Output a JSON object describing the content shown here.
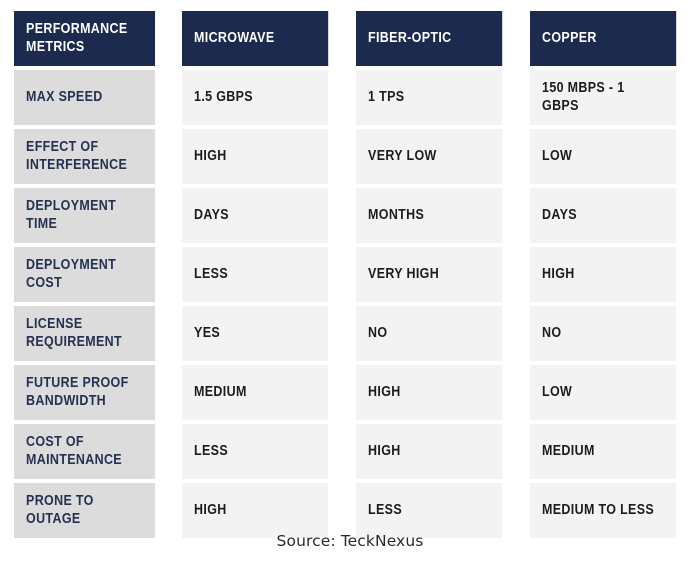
{
  "table": {
    "columns": [
      {
        "key": "metric",
        "label": "PERFORMANCE METRICS",
        "label_line1": "PERFORMANCE",
        "label_line2": "METRICS"
      },
      {
        "key": "microwave",
        "label": "MICROWAVE"
      },
      {
        "key": "fiber",
        "label": "FIBER-OPTIC"
      },
      {
        "key": "copper",
        "label": "COPPER"
      }
    ],
    "rows": [
      {
        "metric": "MAX SPEED",
        "metric_line1": "MAX SPEED",
        "metric_line2": "",
        "microwave": "1.5 GBPS",
        "fiber": "1 TPS",
        "copper": "150 MBPS - 1 GBPS"
      },
      {
        "metric": "EFFECT OF INTERFERENCE",
        "metric_line1": "EFFECT OF",
        "metric_line2": "INTERFERENCE",
        "microwave": "HIGH",
        "fiber": "VERY LOW",
        "copper": "LOW"
      },
      {
        "metric": "DEPLOYMENT TIME",
        "metric_line1": "DEPLOYMENT TIME",
        "metric_line2": "",
        "microwave": "DAYS",
        "fiber": "MONTHS",
        "copper": "DAYS"
      },
      {
        "metric": "DEPLOYMENT COST",
        "metric_line1": "DEPLOYMENT COST",
        "metric_line2": "",
        "microwave": "LESS",
        "fiber": "VERY HIGH",
        "copper": "HIGH"
      },
      {
        "metric": "LICENSE REQUIREMENT",
        "metric_line1": "LICENSE REQUIREMENT",
        "metric_line2": "",
        "microwave": "YES",
        "fiber": "NO",
        "copper": "NO"
      },
      {
        "metric": "FUTURE PROOF BANDWIDTH",
        "metric_line1": "FUTURE PROOF",
        "metric_line2": "BANDWIDTH",
        "microwave": "MEDIUM",
        "fiber": "HIGH",
        "copper": "LOW"
      },
      {
        "metric": "COST OF MAINTENANCE",
        "metric_line1": "COST OF MAINTENANCE",
        "metric_line2": "",
        "microwave": "LESS",
        "fiber": "HIGH",
        "copper": "MEDIUM"
      },
      {
        "metric": "PRONE TO OUTAGE",
        "metric_line1": "PRONE TO OUTAGE",
        "metric_line2": "",
        "microwave": "HIGH",
        "fiber": "LESS",
        "copper": "MEDIUM TO LESS"
      }
    ]
  },
  "footer": {
    "source": "Source: TeckNexus"
  },
  "colors": {
    "header_background": "#1c2a4e",
    "header_text": "#ffffff",
    "metric_cell_background": "#dcdcdc",
    "metric_cell_text": "#24314f",
    "value_cell_background": "#f3f3f3",
    "value_cell_text": "#1c1c1c",
    "page_background": "#ffffff"
  }
}
